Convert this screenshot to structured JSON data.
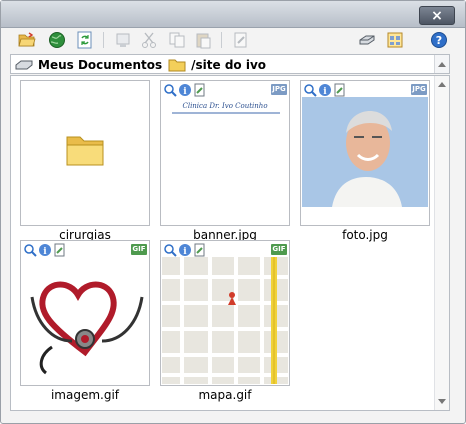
{
  "window": {
    "close_label": "×"
  },
  "toolbar": {
    "buttons": [
      {
        "name": "open-folder",
        "enabled": true
      },
      {
        "name": "globe",
        "enabled": true
      },
      {
        "name": "refresh",
        "enabled": true
      },
      {
        "name": "properties",
        "enabled": false
      },
      {
        "name": "cut",
        "enabled": false
      },
      {
        "name": "copy",
        "enabled": false
      },
      {
        "name": "paste",
        "enabled": false
      },
      {
        "name": "edit",
        "enabled": false
      },
      {
        "name": "drive",
        "enabled": true
      },
      {
        "name": "view-mode",
        "enabled": true
      },
      {
        "name": "help",
        "enabled": true
      }
    ]
  },
  "path": {
    "root": "Meus Documentos",
    "folder": "/site do ivo"
  },
  "items": [
    {
      "name": "cirurgias",
      "type": "folder"
    },
    {
      "name": "banner.jpg",
      "type": "image",
      "badge": "JPG",
      "preview_text": "Clinica Dr. Ivo Coutinho"
    },
    {
      "name": "foto.jpg",
      "type": "image",
      "badge": "JPG"
    },
    {
      "name": "imagem.gif",
      "type": "image",
      "badge": "GIF"
    },
    {
      "name": "mapa.gif",
      "type": "image",
      "badge": "GIF"
    }
  ],
  "colors": {
    "jpg_badge": "#7c9bc4",
    "gif_badge": "#4e9a4e",
    "folder": "#f3cf5a",
    "accent": "#2f6fc8"
  }
}
